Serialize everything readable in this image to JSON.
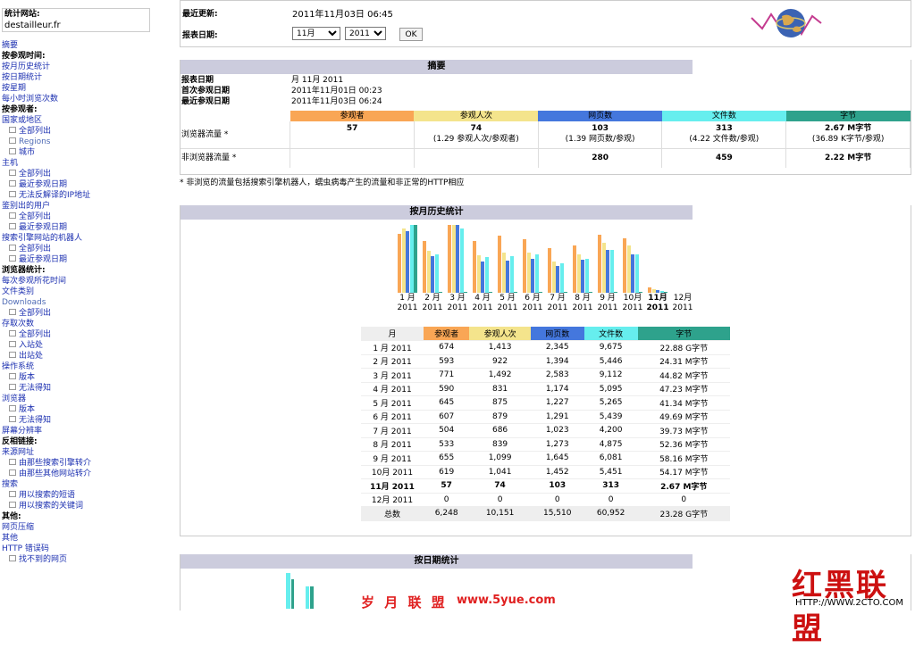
{
  "sidebar": {
    "site_label": "统计网站:",
    "site_name": "destailleur.fr",
    "items": [
      {
        "t": "摘要",
        "k": "l"
      },
      {
        "t": "按参观时间:",
        "k": "h"
      },
      {
        "t": "按月历史统计",
        "k": "l"
      },
      {
        "t": "按日期统计",
        "k": "l"
      },
      {
        "t": "按星期",
        "k": "l"
      },
      {
        "t": "每小时浏览次数",
        "k": "l"
      },
      {
        "t": "按参观者:",
        "k": "h"
      },
      {
        "t": "国家或地区",
        "k": "l"
      },
      {
        "t": "全部列出",
        "k": "sub"
      },
      {
        "t": "Regions",
        "k": "subgray"
      },
      {
        "t": "城市",
        "k": "sub"
      },
      {
        "t": "主机",
        "k": "l"
      },
      {
        "t": "全部列出",
        "k": "sub"
      },
      {
        "t": "最近参观日期",
        "k": "sub"
      },
      {
        "t": "无法反解译的IP地址",
        "k": "sub"
      },
      {
        "t": "鉴别出的用户",
        "k": "l"
      },
      {
        "t": "全部列出",
        "k": "sub"
      },
      {
        "t": "最近参观日期",
        "k": "sub"
      },
      {
        "t": "搜索引擎网站的机器人",
        "k": "l"
      },
      {
        "t": "全部列出",
        "k": "sub"
      },
      {
        "t": "最近参观日期",
        "k": "sub"
      },
      {
        "t": "浏览器统计:",
        "k": "h"
      },
      {
        "t": "每次参观所花时间",
        "k": "l"
      },
      {
        "t": "文件类别",
        "k": "l"
      },
      {
        "t": "Downloads",
        "k": "gray"
      },
      {
        "t": "全部列出",
        "k": "sub"
      },
      {
        "t": "存取次数",
        "k": "l"
      },
      {
        "t": "全部列出",
        "k": "sub"
      },
      {
        "t": "入站处",
        "k": "sub"
      },
      {
        "t": "出站处",
        "k": "sub"
      },
      {
        "t": "操作系统",
        "k": "l"
      },
      {
        "t": "版本",
        "k": "sub"
      },
      {
        "t": "无法得知",
        "k": "sub"
      },
      {
        "t": "浏览器",
        "k": "l"
      },
      {
        "t": "版本",
        "k": "sub"
      },
      {
        "t": "无法得知",
        "k": "sub"
      },
      {
        "t": "屏幕分辨率",
        "k": "l"
      },
      {
        "t": "反相链接:",
        "k": "h"
      },
      {
        "t": "来源网址",
        "k": "l"
      },
      {
        "t": "由那些搜索引擎转介",
        "k": "sub"
      },
      {
        "t": "由那些其他网站转介",
        "k": "sub"
      },
      {
        "t": "搜索",
        "k": "l"
      },
      {
        "t": "用以搜索的短语",
        "k": "sub"
      },
      {
        "t": "用以搜索的关键词",
        "k": "sub"
      },
      {
        "t": "其他:",
        "k": "h"
      },
      {
        "t": "网页压缩",
        "k": "l"
      },
      {
        "t": "其他",
        "k": "l"
      },
      {
        "t": "HTTP 错误码",
        "k": "l"
      },
      {
        "t": "找不到的网页",
        "k": "sub"
      }
    ]
  },
  "top": {
    "last_update_label": "最近更新:",
    "last_update_value": "2011年11月03日 06:45",
    "report_date_label": "报表日期:",
    "month_selected": "11月",
    "year_selected": "2011",
    "ok_label": "OK"
  },
  "summary": {
    "title": "摘要",
    "rows": [
      {
        "label": "报表日期",
        "value": "月 11月 2011"
      },
      {
        "label": "首次参观日期",
        "value": "2011年11月01日 00:23"
      },
      {
        "label": "最近参观日期",
        "value": "2011年11月03日 06:24"
      }
    ],
    "headers": [
      "参观者",
      "参观人次",
      "网页数",
      "文件数",
      "字节"
    ],
    "viewed_label": "浏览器流量 *",
    "viewed": [
      {
        "v": "57",
        "s": ""
      },
      {
        "v": "74",
        "s": "(1.29 参观人次/参观者)"
      },
      {
        "v": "103",
        "s": "(1.39 网页数/参观)"
      },
      {
        "v": "313",
        "s": "(4.22 文件数/参观)"
      },
      {
        "v": "2.67 M字节",
        "s": "(36.89 K字节/参观)"
      }
    ],
    "notviewed_label": "非浏览器流量 *",
    "notviewed": [
      "",
      "",
      "280",
      "459",
      "2.22 M字节"
    ],
    "footnote": "* 非浏览的流量包括搜索引擎机器人，蠕虫病毒产生的流量和非正常的HTTP相应"
  },
  "monthly": {
    "title": "按月历史统计",
    "headers": [
      "月",
      "参观者",
      "参观人次",
      "网页数",
      "文件数",
      "字节"
    ],
    "rows": [
      {
        "m": "1 月 2011",
        "v": "674",
        "vi": "1,413",
        "p": "2,345",
        "f": "9,675",
        "b": "22.88 G字节"
      },
      {
        "m": "2 月 2011",
        "v": "593",
        "vi": "922",
        "p": "1,394",
        "f": "5,446",
        "b": "24.31 M字节"
      },
      {
        "m": "3 月 2011",
        "v": "771",
        "vi": "1,492",
        "p": "2,583",
        "f": "9,112",
        "b": "44.82 M字节"
      },
      {
        "m": "4 月 2011",
        "v": "590",
        "vi": "831",
        "p": "1,174",
        "f": "5,095",
        "b": "47.23 M字节"
      },
      {
        "m": "5 月 2011",
        "v": "645",
        "vi": "875",
        "p": "1,227",
        "f": "5,265",
        "b": "41.34 M字节"
      },
      {
        "m": "6 月 2011",
        "v": "607",
        "vi": "879",
        "p": "1,291",
        "f": "5,439",
        "b": "49.69 M字节"
      },
      {
        "m": "7 月 2011",
        "v": "504",
        "vi": "686",
        "p": "1,023",
        "f": "4,200",
        "b": "39.73 M字节"
      },
      {
        "m": "8 月 2011",
        "v": "533",
        "vi": "839",
        "p": "1,273",
        "f": "4,875",
        "b": "52.36 M字节"
      },
      {
        "m": "9 月 2011",
        "v": "655",
        "vi": "1,099",
        "p": "1,645",
        "f": "6,081",
        "b": "58.16 M字节"
      },
      {
        "m": "10月 2011",
        "v": "619",
        "vi": "1,041",
        "p": "1,452",
        "f": "5,451",
        "b": "54.17 M字节"
      },
      {
        "m": "11月 2011",
        "v": "57",
        "vi": "74",
        "p": "103",
        "f": "313",
        "b": "2.67 M字节"
      },
      {
        "m": "12月 2011",
        "v": "0",
        "vi": "0",
        "p": "0",
        "f": "0",
        "b": "0"
      }
    ],
    "total": {
      "m": "总数",
      "v": "6,248",
      "vi": "10,151",
      "p": "15,510",
      "f": "60,952",
      "b": "23.28 G字节"
    },
    "chart_labels": [
      [
        "1 月",
        "2011"
      ],
      [
        "2 月",
        "2011"
      ],
      [
        "3 月",
        "2011"
      ],
      [
        "4 月",
        "2011"
      ],
      [
        "5 月",
        "2011"
      ],
      [
        "6 月",
        "2011"
      ],
      [
        "7 月",
        "2011"
      ],
      [
        "8 月",
        "2011"
      ],
      [
        "9 月",
        "2011"
      ],
      [
        "10月",
        "2011"
      ],
      [
        "11月",
        "2011"
      ],
      [
        "12月",
        "2011"
      ]
    ]
  },
  "chart_data": {
    "type": "bar",
    "categories": [
      "1 月 2011",
      "2 月 2011",
      "3 月 2011",
      "4 月 2011",
      "5 月 2011",
      "6 月 2011",
      "7 月 2011",
      "8 月 2011",
      "9 月 2011",
      "10月 2011",
      "11月 2011",
      "12月 2011"
    ],
    "series": [
      {
        "name": "参观者",
        "values": [
          674,
          593,
          771,
          590,
          645,
          607,
          504,
          533,
          655,
          619,
          57,
          0
        ],
        "color": "#f9a655"
      },
      {
        "name": "参观人次",
        "values": [
          1413,
          922,
          1492,
          831,
          875,
          879,
          686,
          839,
          1099,
          1041,
          74,
          0
        ],
        "color": "#f4e48c"
      },
      {
        "name": "网页数",
        "values": [
          2345,
          1394,
          2583,
          1174,
          1227,
          1291,
          1023,
          1273,
          1645,
          1452,
          103,
          0
        ],
        "color": "#4477dd"
      },
      {
        "name": "文件数",
        "values": [
          9675,
          5446,
          9112,
          5095,
          5265,
          5439,
          4200,
          4875,
          6081,
          5451,
          313,
          0
        ],
        "color": "#66eeee"
      },
      {
        "name": "字节",
        "values": [
          22.88,
          0.02431,
          0.04482,
          0.04723,
          0.04134,
          0.04969,
          0.03973,
          0.05236,
          0.05816,
          0.05417,
          0.00267,
          0
        ],
        "unit": "G字节",
        "color": "#2ea28c"
      }
    ]
  },
  "daily": {
    "title": "按日期统计"
  },
  "watermarks": {
    "left": "岁 月 联 盟",
    "mid": "www.5yue.com",
    "right": "红黑联盟",
    "url": "HTTP://WWW.2CTO.COM"
  }
}
